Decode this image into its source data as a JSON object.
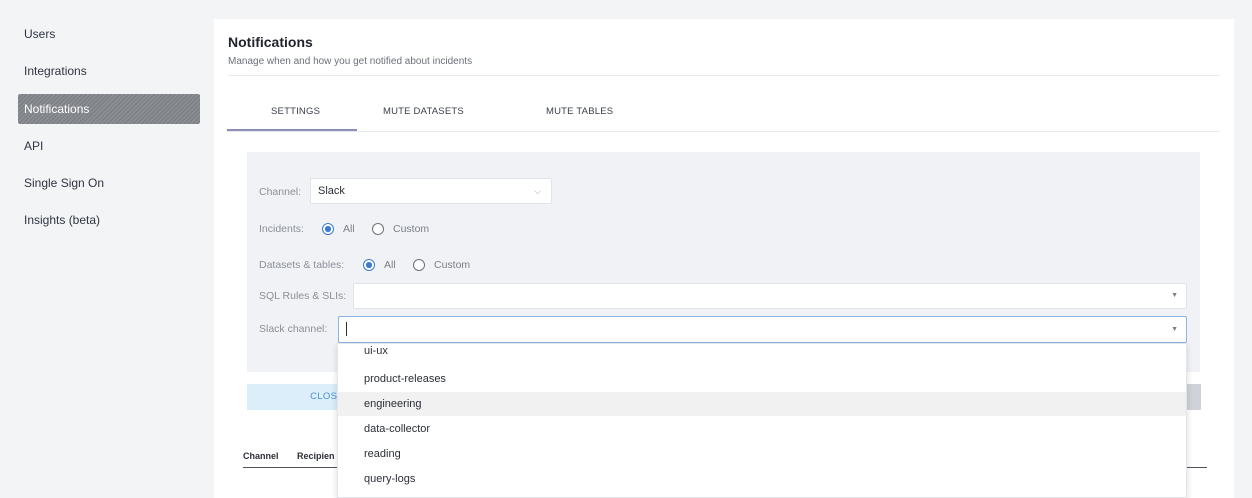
{
  "sidebar": {
    "items": [
      {
        "label": "Users"
      },
      {
        "label": "Integrations"
      },
      {
        "label": "Notifications"
      },
      {
        "label": "API"
      },
      {
        "label": "Single Sign On"
      },
      {
        "label": "Insights (beta)"
      }
    ],
    "active_index": 2
  },
  "header": {
    "title": "Notifications",
    "subtitle": "Manage when and how you get notified about incidents"
  },
  "tabs": [
    {
      "label": "SETTINGS"
    },
    {
      "label": "MUTE DATASETS"
    },
    {
      "label": "MUTE TABLES"
    }
  ],
  "form": {
    "channel_label": "Channel:",
    "channel_value": "Slack",
    "incidents_label": "Incidents:",
    "incidents_all": "All",
    "incidents_custom": "Custom",
    "datasets_label": "Datasets & tables:",
    "datasets_all": "All",
    "datasets_custom": "Custom",
    "sql_label": "SQL Rules & SLIs:",
    "sql_value": "",
    "slack_label": "Slack channel:",
    "slack_value": ""
  },
  "buttons": {
    "close_label": "CLOSE"
  },
  "table": {
    "headers": [
      "Channel",
      "Recipien"
    ]
  },
  "dropdown": {
    "options": [
      "ui-ux",
      "product-releases",
      "engineering",
      "data-collector",
      "reading",
      "query-logs"
    ],
    "highlighted_index": 2
  },
  "colors": {
    "accent": "#3b7bd4",
    "tab_underline": "#8a8fb8",
    "sidebar_active": "#808388"
  }
}
